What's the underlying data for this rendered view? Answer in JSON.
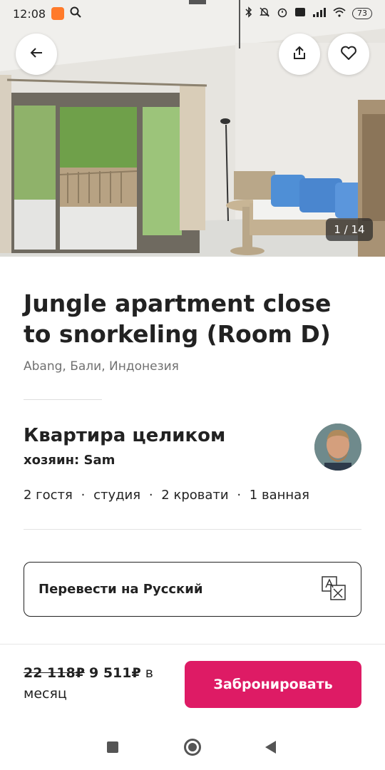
{
  "status_bar": {
    "time": "12:08",
    "battery": "73",
    "icons": [
      "app-notification-icon",
      "search-icon",
      "bluetooth-icon",
      "alarm-off-icon",
      "alarm-icon",
      "volte-icon",
      "signal-icon",
      "wifi-icon",
      "battery-icon"
    ]
  },
  "gallery": {
    "counter": "1 / 14"
  },
  "listing": {
    "title": "Jungle apartment close to snorkeling (Room D)",
    "location": "Abang, Бали, Индонезия",
    "type": "Квартира целиком",
    "host": "хозяин: Sam",
    "details": [
      "2 гостя",
      "студия",
      "2 кровати",
      "1 ванная"
    ],
    "separator": "·"
  },
  "translate": {
    "label": "Перевести на Русский"
  },
  "booking": {
    "price_old": "22 118₽",
    "price_new": "9 511₽",
    "price_period": "в месяц",
    "button_label": "Забронировать"
  },
  "colors": {
    "brand": "#de1b65",
    "text": "#222222",
    "muted": "#717171"
  }
}
